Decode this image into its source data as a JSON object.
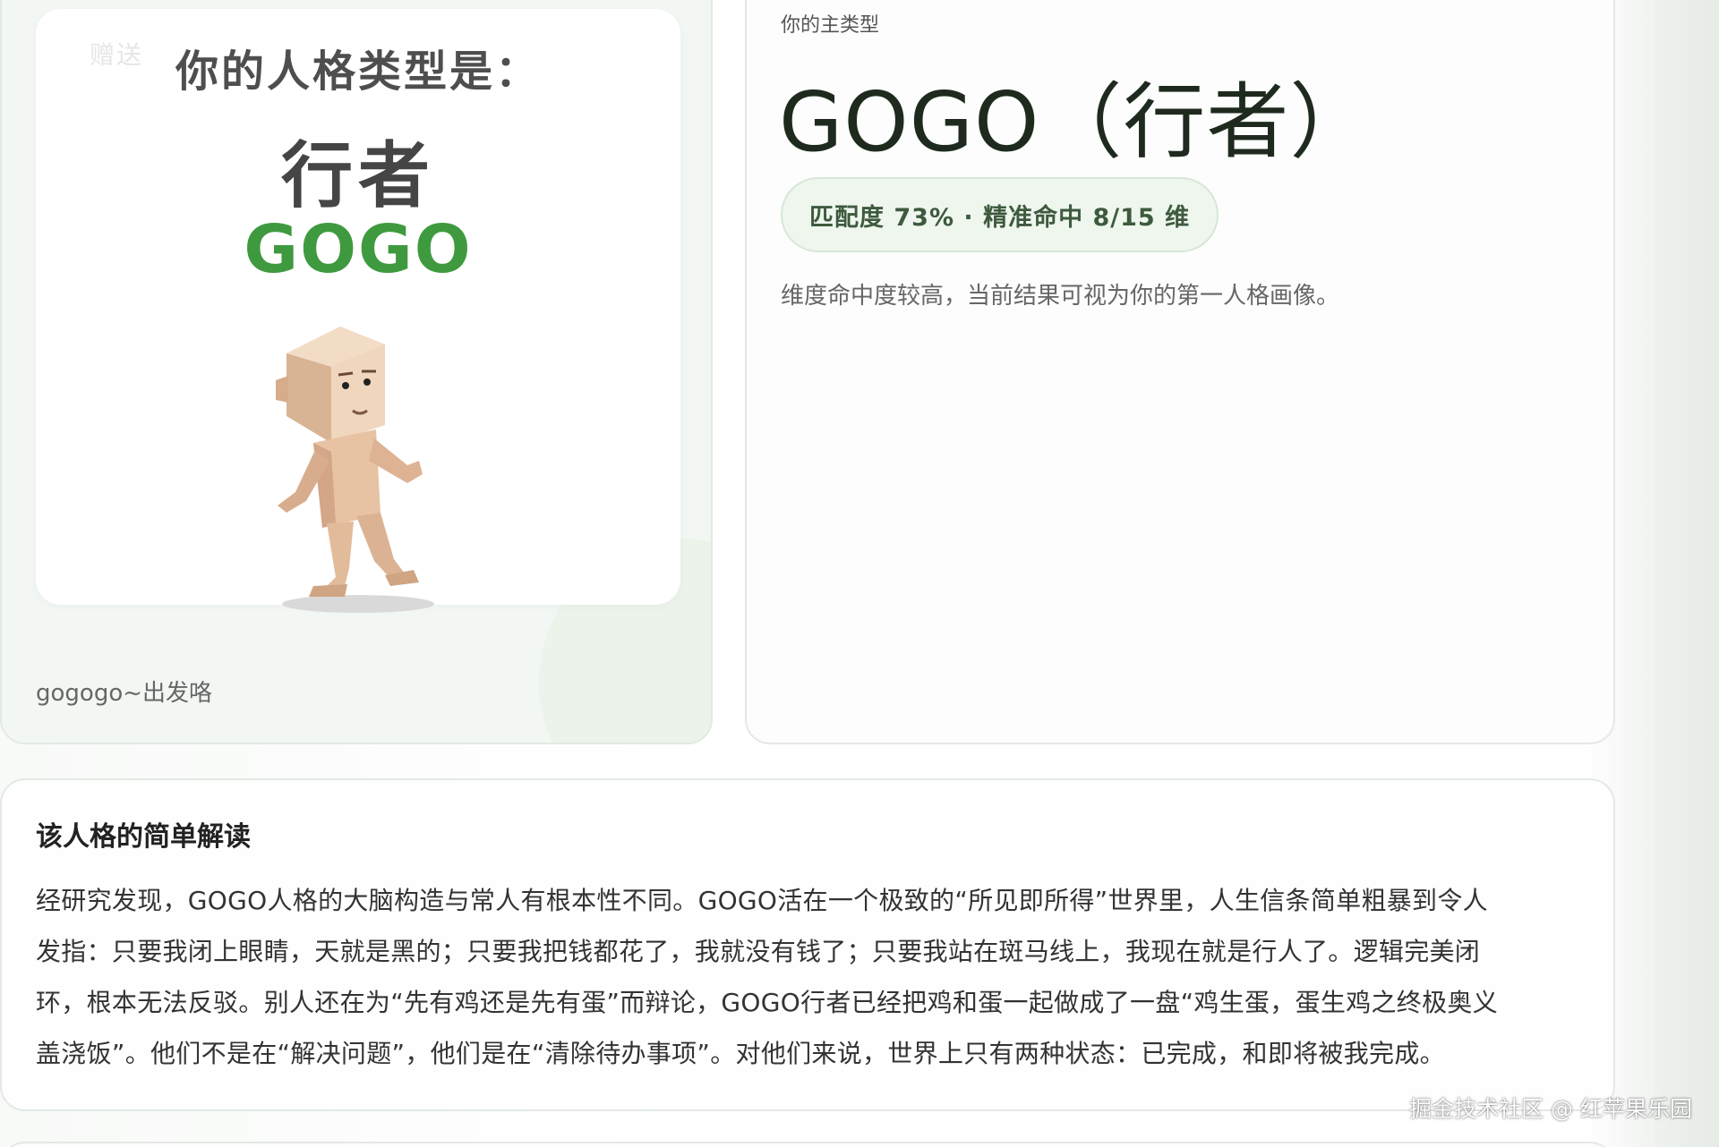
{
  "poster": {
    "faint_text": "赠送",
    "title": "你的人格类型是：",
    "name_cn": "行者",
    "name_en": "GOGO",
    "caption": "gogogo~出发咯",
    "figure_icon": "walking-figure-icon",
    "colors": {
      "name_en": "#3f9a3f"
    }
  },
  "result": {
    "label": "你的主类型",
    "type_name": "GOGO（行者）",
    "match_badge": "匹配度 73% · 精准命中 8/15 维",
    "match_percent": 73,
    "dims_hit": 8,
    "dims_total": 15,
    "description": "维度命中度较高，当前结果可视为你的第一人格画像。"
  },
  "reading": {
    "title": "该人格的简单解读",
    "lines": [
      "经研究发现，GOGO人格的大脑构造与常人有根本性不同。GOGO活在一个极致的“所见即所得”世界里，人生信条简单粗暴到令人",
      "发指：只要我闭上眼睛，天就是黑的；只要我把钱都花了，我就没有钱了；只要我站在斑马线上，我现在就是行人了。逻辑完美闭",
      "环，根本无法反驳。别人还在为“先有鸡还是先有蛋”而辩论，GOGO行者已经把鸡和蛋一起做成了一盘“鸡生蛋，蛋生鸡之终极奥义",
      "盖浇饭”。他们不是在“解决问题”，他们是在“清除待办事项”。对他们来说，世界上只有两种状态：已完成，和即将被我完成。"
    ]
  },
  "watermark": "掘金技术社区 @ 红苹果乐园"
}
